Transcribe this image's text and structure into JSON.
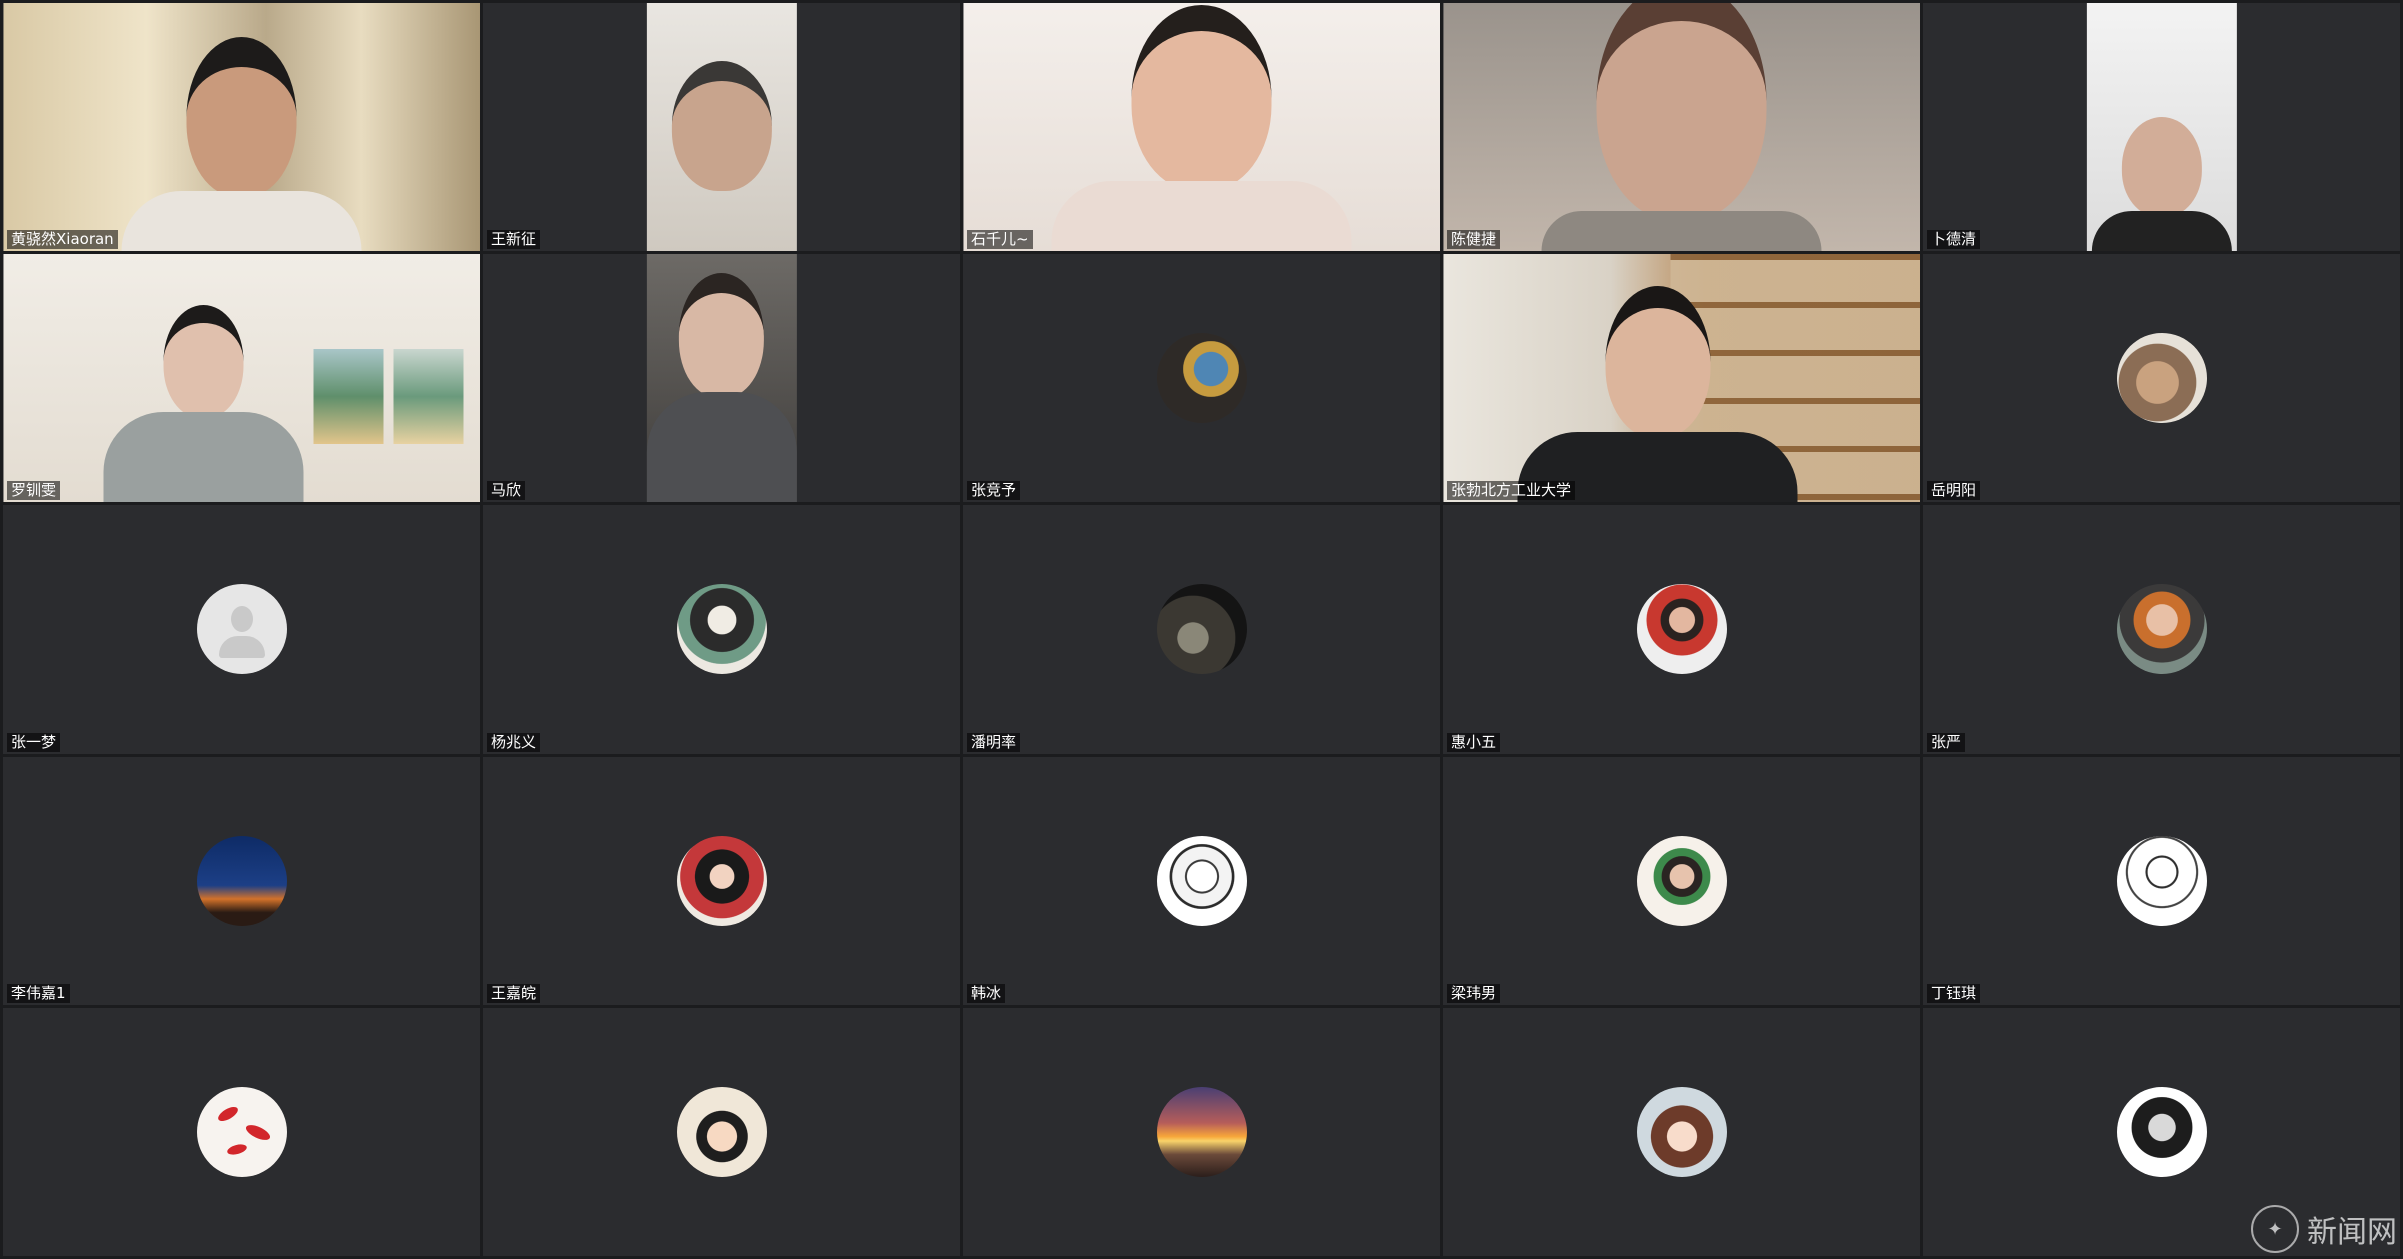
{
  "participants": [
    {
      "name": "黄骁然Xiaoran",
      "type": "video",
      "video": "curtain"
    },
    {
      "name": "王新征",
      "type": "video",
      "video": "wall"
    },
    {
      "name": "石千儿~",
      "type": "video",
      "video": "bright"
    },
    {
      "name": "陈健捷",
      "type": "video",
      "video": "grey"
    },
    {
      "name": "卜德清",
      "type": "video",
      "video": "white"
    },
    {
      "name": "罗钏雯",
      "type": "video",
      "video": "room"
    },
    {
      "name": "马欣",
      "type": "video",
      "video": "dark"
    },
    {
      "name": "张竞予",
      "type": "avatar",
      "avatar": "photo-avatar"
    },
    {
      "name": "张勃北方工业大学",
      "type": "video",
      "video": "study"
    },
    {
      "name": "岳明阳",
      "type": "avatar",
      "avatar": "photo-avatar"
    },
    {
      "name": "张一梦",
      "type": "avatar",
      "avatar": "default-avatar"
    },
    {
      "name": "杨兆义",
      "type": "avatar",
      "avatar": "illustration-avatar"
    },
    {
      "name": "潘明率",
      "type": "avatar",
      "avatar": "photo-avatar"
    },
    {
      "name": "惠小五",
      "type": "avatar",
      "avatar": "photo-avatar"
    },
    {
      "name": "张严",
      "type": "avatar",
      "avatar": "photo-avatar"
    },
    {
      "name": "李伟嘉1",
      "type": "avatar",
      "avatar": "night-avatar"
    },
    {
      "name": "王嘉皖",
      "type": "avatar",
      "avatar": "illustration-avatar"
    },
    {
      "name": "韩冰",
      "type": "avatar",
      "avatar": "sketch-avatar"
    },
    {
      "name": "梁玮男",
      "type": "avatar",
      "avatar": "photo-avatar"
    },
    {
      "name": "丁钰琪",
      "type": "avatar",
      "avatar": "sketch-avatar"
    },
    {
      "name": "",
      "type": "avatar",
      "avatar": "bird-avatar"
    },
    {
      "name": "",
      "type": "avatar",
      "avatar": "cartoon-avatar"
    },
    {
      "name": "",
      "type": "avatar",
      "avatar": "sunset-avatar"
    },
    {
      "name": "",
      "type": "avatar",
      "avatar": "anime-avatar"
    },
    {
      "name": "",
      "type": "avatar",
      "avatar": "sketch-avatar"
    }
  ],
  "watermark": {
    "text": "新闻网"
  },
  "colors": {
    "background": "#1b1c1e",
    "tile": "#2b2c2f",
    "name_tag_text": "#ffffff"
  }
}
